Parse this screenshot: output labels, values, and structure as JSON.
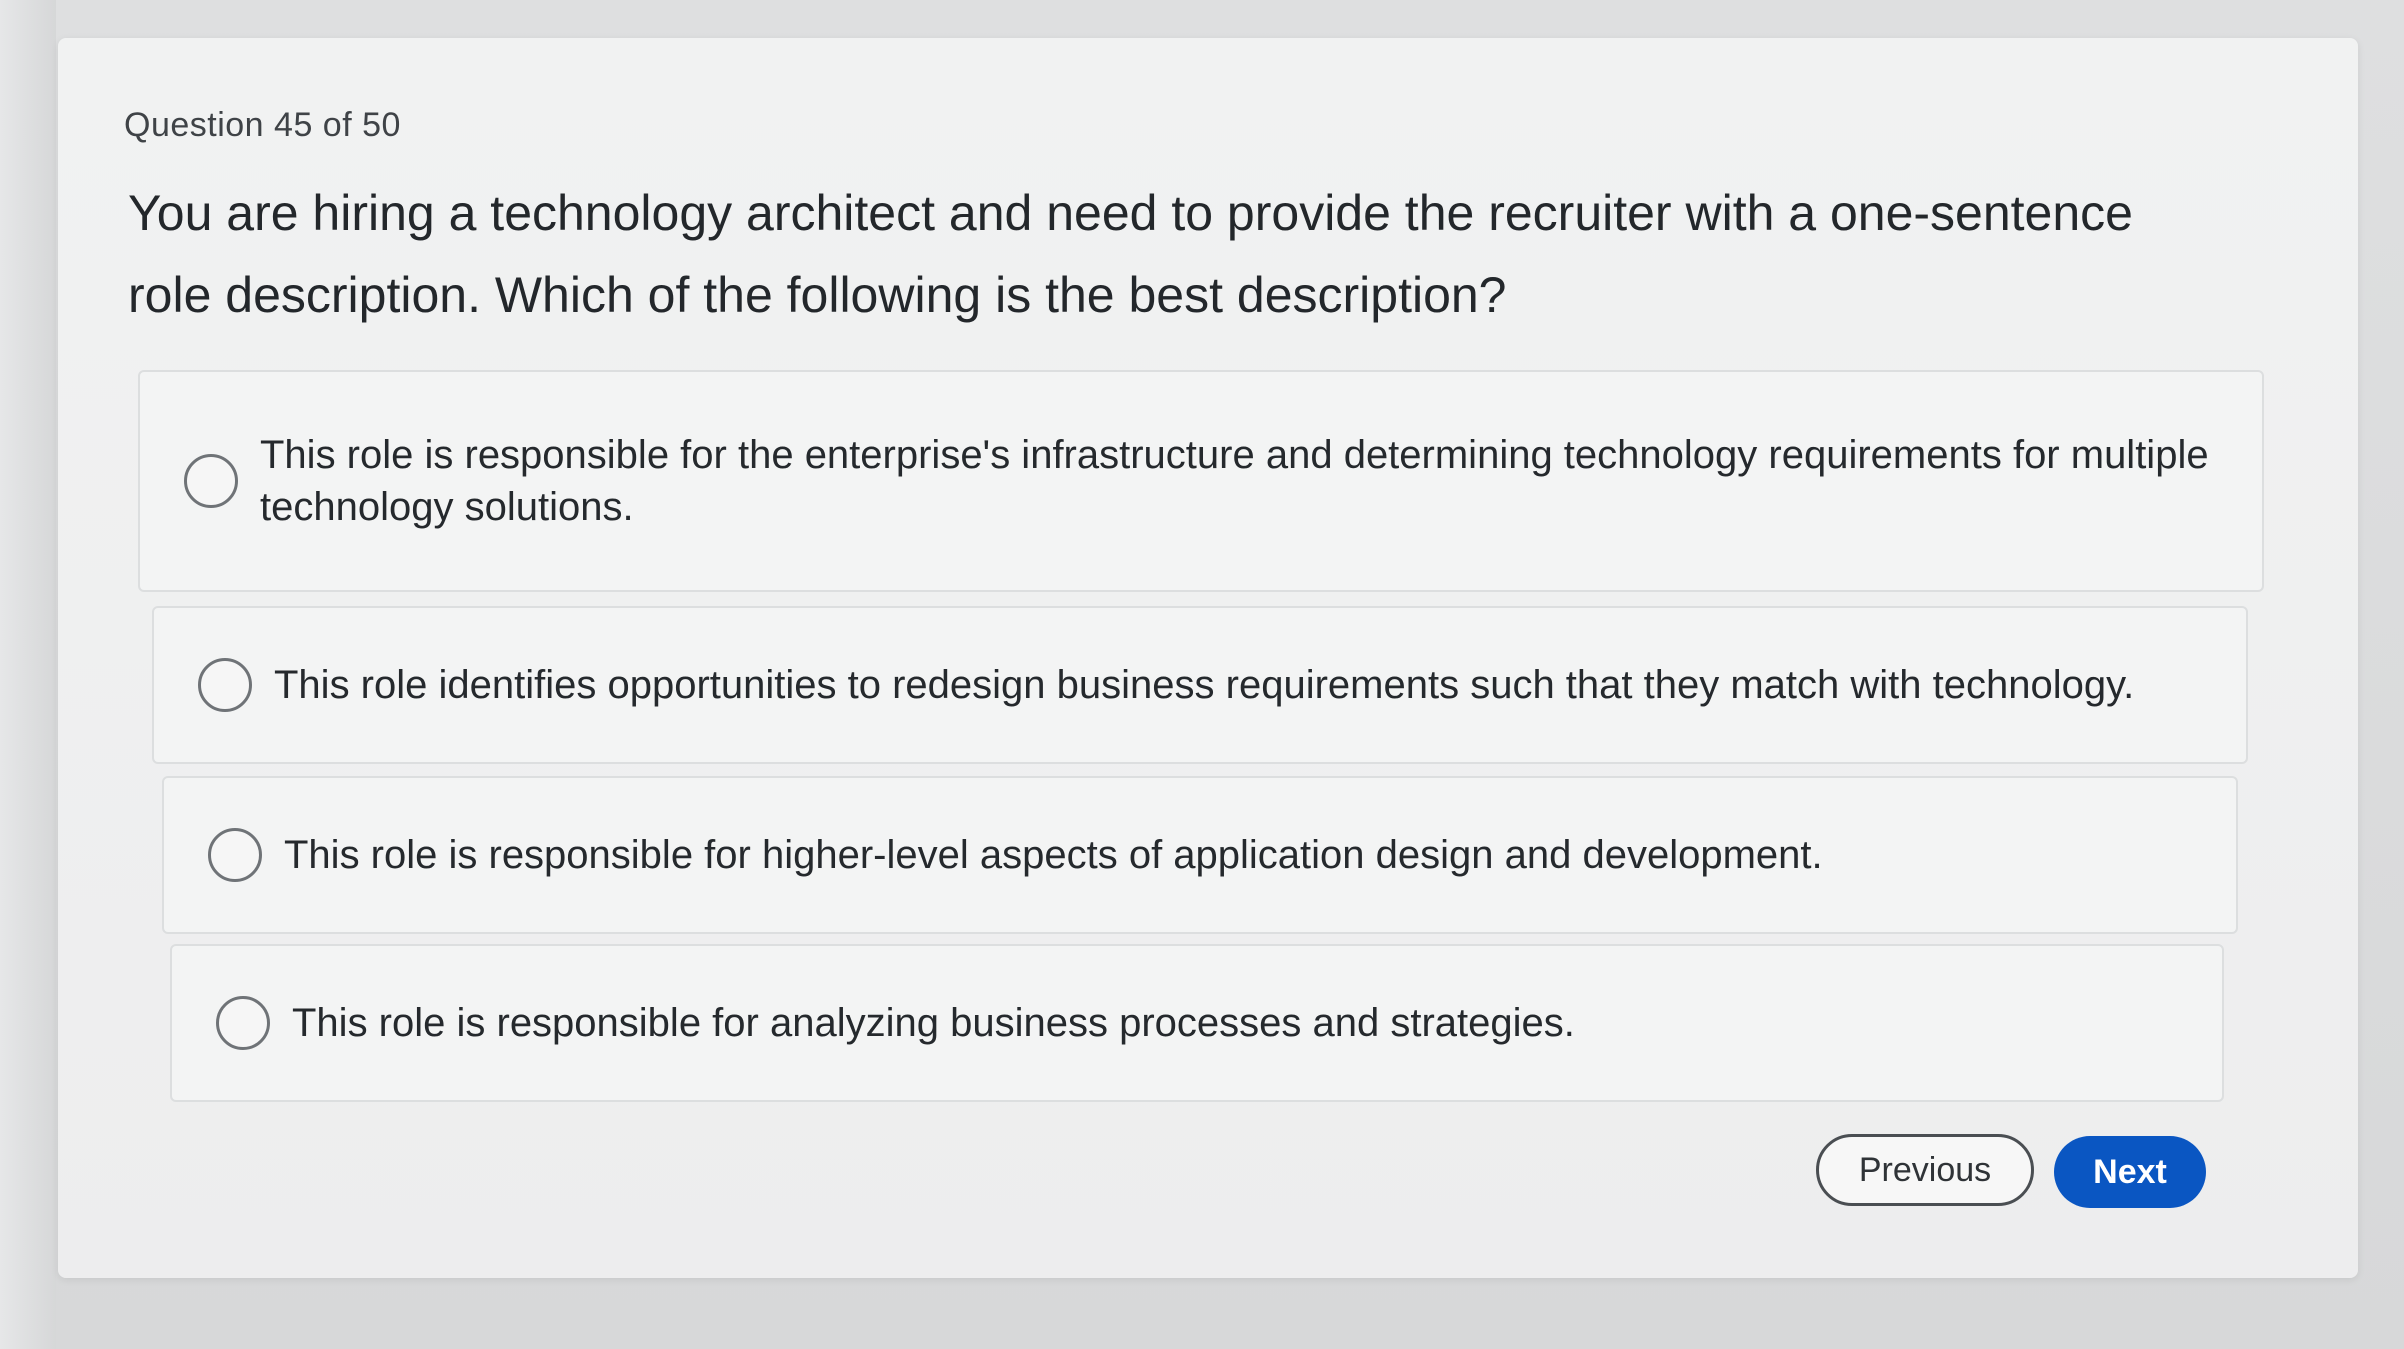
{
  "quiz": {
    "counter": "Question 45 of 50",
    "question": "You are hiring a technology architect and need to provide the recruiter with a one-sentence role description. Which of the following is the best description?",
    "options": [
      {
        "label": "This role is responsible for the enterprise's infrastructure and determining technology requirements for multiple technology solutions.",
        "selected": false
      },
      {
        "label": "This role identifies opportunities to redesign business requirements such that they match with technology.",
        "selected": false
      },
      {
        "label": "This role is responsible for higher-level aspects of application design and development.",
        "selected": false
      },
      {
        "label": "This role is responsible for analyzing business processes and strategies.",
        "selected": false
      }
    ]
  },
  "nav": {
    "previous_label": "Previous",
    "next_label": "Next"
  },
  "colors": {
    "accent": "#0a56c2",
    "card_background": "#efeff0",
    "text": "#23272b"
  }
}
